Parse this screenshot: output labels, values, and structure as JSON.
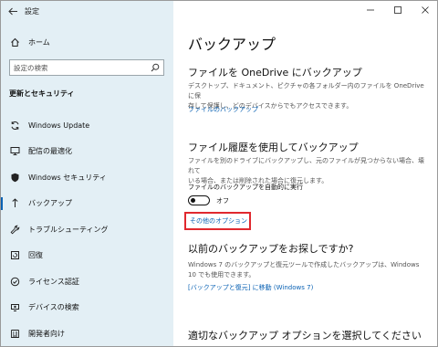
{
  "window": {
    "title": "設定"
  },
  "sidebar": {
    "home_label": "ホーム",
    "search_placeholder": "設定の検索",
    "section_title": "更新とセキュリティ",
    "items": [
      {
        "label": "Windows Update",
        "icon": "sync-icon"
      },
      {
        "label": "配信の最適化",
        "icon": "delivery-optimization-icon"
      },
      {
        "label": "Windows セキュリティ",
        "icon": "shield-icon"
      },
      {
        "label": "バックアップ",
        "icon": "backup-arrow-icon",
        "active": true
      },
      {
        "label": "トラブルシューティング",
        "icon": "wrench-icon"
      },
      {
        "label": "回復",
        "icon": "recovery-icon"
      },
      {
        "label": "ライセンス認証",
        "icon": "check-circle-icon"
      },
      {
        "label": "デバイスの検索",
        "icon": "find-device-icon"
      },
      {
        "label": "開発者向け",
        "icon": "developer-icon"
      }
    ]
  },
  "content": {
    "page_title": "バックアップ",
    "onedrive": {
      "heading": "ファイルを OneDrive にバックアップ",
      "line1": "デスクトップ、ドキュメント、ピクチャの各フォルダー内のファイルを OneDrive に保",
      "line2": "存して保護し、どのデバイスからでもアクセスできます。",
      "link": "ファイルのバックアップ"
    },
    "file_history": {
      "heading": "ファイル履歴を使用してバックアップ",
      "line1": "ファイルを別のドライブにバックアップし、元のファイルが見つからない場合、壊れて",
      "line2": "いる場合、または削除された場合に復元します。",
      "toggle_label": "ファイルのバックアップを自動的に実行",
      "toggle_state": "オフ",
      "more_options": "その他のオプション"
    },
    "older_backup": {
      "heading": "以前のバックアップをお探しですか?",
      "line1": "Windows 7 のバックアップと復元ツールで作成したバックアップは、Windows",
      "line2": "10 でも使用できます。",
      "link": "[バックアップと復元] に移動 (Windows 7)"
    },
    "select_option": {
      "heading": "適切なバックアップ オプションを選択してください"
    }
  },
  "colors": {
    "sidebar_bg": "#e3eff5",
    "link": "#0a62b4",
    "highlight": "#e0282e"
  }
}
